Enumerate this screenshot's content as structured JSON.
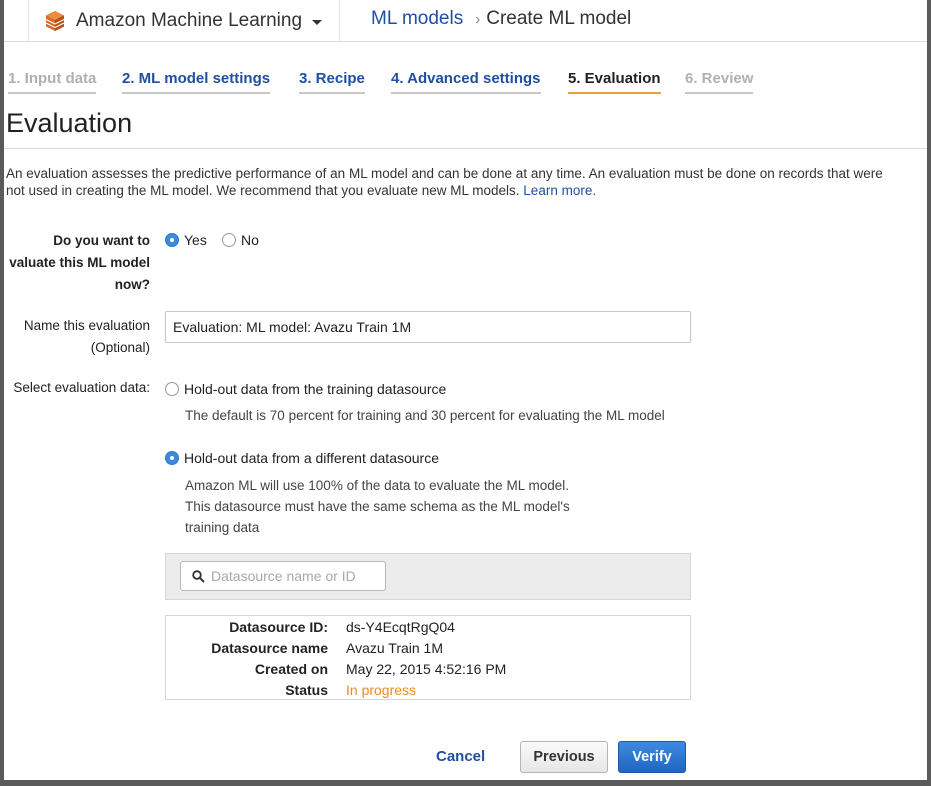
{
  "header": {
    "service_name": "Amazon Machine Learning",
    "breadcrumb_parent": "ML models",
    "breadcrumb_separator": "›",
    "breadcrumb_current": "Create ML model"
  },
  "steps": [
    {
      "label": "1. Input data",
      "state": "done"
    },
    {
      "label": "2. ML model settings",
      "state": "link"
    },
    {
      "label": "3. Recipe",
      "state": "link"
    },
    {
      "label": "4. Advanced settings",
      "state": "link"
    },
    {
      "label": "5. Evaluation",
      "state": "active"
    },
    {
      "label": "6. Review",
      "state": "future"
    }
  ],
  "page": {
    "title": "Evaluation",
    "intro_line1": "An evaluation assesses the predictive performance of an ML model and can be done at any time. An evaluation must be done on records that were",
    "intro_line2": "not used in creating the ML model. We recommend that you evaluate new ML models.",
    "learn_more": "Learn more."
  },
  "form": {
    "evaluate_question_l1": "Do you want to",
    "evaluate_question_l2": "valuate this ML model",
    "evaluate_question_l3": "now?",
    "yes_label": "Yes",
    "no_label": "No",
    "evaluate_selected": "Yes",
    "name_label_l1": "Name this evaluation",
    "name_label_l2": "(Optional)",
    "name_value": "Evaluation: ML model: Avazu Train 1M",
    "select_data_label": "Select evaluation data:",
    "option1_label": "Hold-out data from the training datasource",
    "option1_help": "The default is 70 percent for training and 30 percent for evaluating the ML model",
    "option2_label": "Hold-out data from a different datasource",
    "option2_help_l1": "Amazon ML will use 100% of the data to evaluate the ML model.",
    "option2_help_l2": "This datasource must have the same schema as the ML model's",
    "option2_help_l3": "training data",
    "data_selected": "option2",
    "search_placeholder": "Datasource name or ID"
  },
  "datasource": {
    "id_label": "Datasource ID:",
    "id_value": "ds-Y4EcqtRgQ04",
    "name_label": "Datasource name",
    "name_value": "Avazu Train 1M",
    "created_label": "Created on",
    "created_value": "May 22, 2015 4:52:16 PM",
    "status_label": "Status",
    "status_value": "In progress",
    "status_color": "#f08a1c"
  },
  "buttons": {
    "cancel": "Cancel",
    "previous": "Previous",
    "verify": "Verify"
  },
  "icons": {
    "logo": "amazon-ml-cube-icon",
    "caret": "chevron-down-icon",
    "search": "search-icon"
  },
  "colors": {
    "link": "#1f4fa3",
    "active_step_underline": "#f0a030",
    "primary_button": "#2f78c8"
  }
}
